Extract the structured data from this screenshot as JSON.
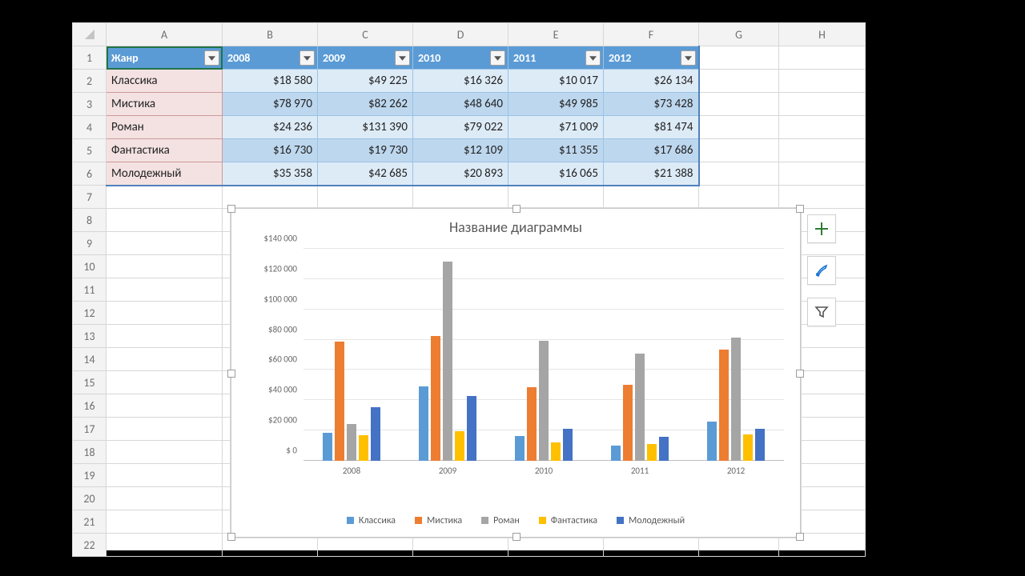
{
  "columns": [
    "A",
    "B",
    "C",
    "D",
    "E",
    "F",
    "G",
    "H"
  ],
  "row_numbers": [
    1,
    2,
    3,
    4,
    5,
    6,
    7,
    8,
    9,
    10,
    11,
    12,
    13,
    14,
    15,
    16,
    17,
    18,
    19,
    20,
    21,
    22
  ],
  "table": {
    "headers": [
      "Жанр",
      "2008",
      "2009",
      "2010",
      "2011",
      "2012"
    ],
    "rows": [
      {
        "label": "Классика",
        "values": [
          "$18 580",
          "$49 225",
          "$16 326",
          "$10 017",
          "$26 134"
        ]
      },
      {
        "label": "Мистика",
        "values": [
          "$78 970",
          "$82 262",
          "$48 640",
          "$49 985",
          "$73 428"
        ]
      },
      {
        "label": "Роман",
        "values": [
          "$24 236",
          "$131 390",
          "$79 022",
          "$71 009",
          "$81 474"
        ]
      },
      {
        "label": "Фантастика",
        "values": [
          "$16 730",
          "$19 730",
          "$12 109",
          "$11 355",
          "$17 686"
        ]
      },
      {
        "label": "Молодежный",
        "values": [
          "$35 358",
          "$42 685",
          "$20 893",
          "$16 065",
          "$21 388"
        ]
      }
    ]
  },
  "chart_title": "Название диаграммы",
  "y_ticks": [
    "$ 0",
    "$20 000",
    "$40 000",
    "$60 000",
    "$80 000",
    "$100 000",
    "$120 000",
    "$140 000"
  ],
  "chart_data": {
    "type": "bar",
    "title": "Название диаграммы",
    "categories": [
      "2008",
      "2009",
      "2010",
      "2011",
      "2012"
    ],
    "series": [
      {
        "name": "Классика",
        "values": [
          18580,
          49225,
          16326,
          10017,
          26134
        ]
      },
      {
        "name": "Мистика",
        "values": [
          78970,
          82262,
          48640,
          49985,
          73428
        ]
      },
      {
        "name": "Роман",
        "values": [
          24236,
          131390,
          79022,
          71009,
          81474
        ]
      },
      {
        "name": "Фантастика",
        "values": [
          16730,
          19730,
          12109,
          11355,
          17686
        ]
      },
      {
        "name": "Молодежный",
        "values": [
          35358,
          42685,
          20893,
          16065,
          21388
        ]
      }
    ],
    "ylim": [
      0,
      140000
    ],
    "xlabel": "",
    "ylabel": ""
  }
}
